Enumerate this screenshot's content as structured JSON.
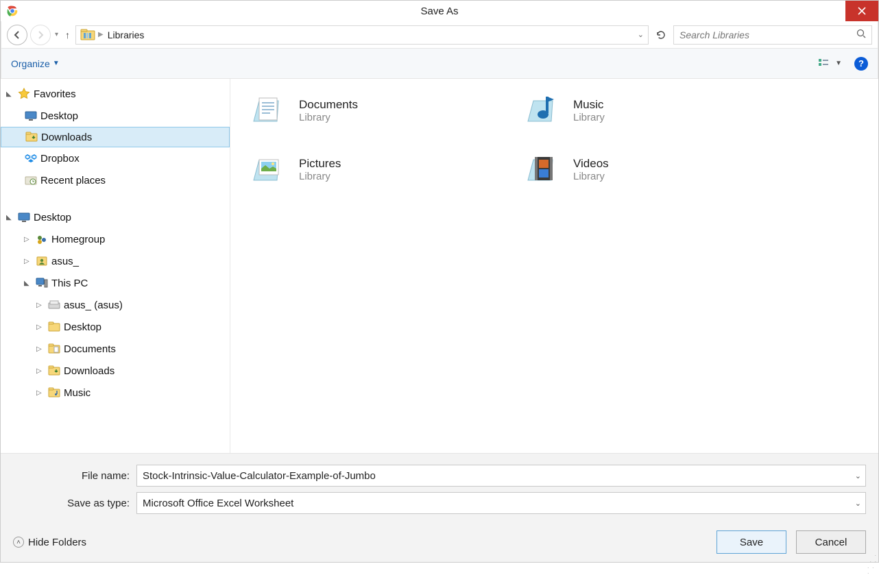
{
  "title": "Save As",
  "breadcrumb": {
    "location": "Libraries"
  },
  "search": {
    "placeholder": "Search Libraries"
  },
  "toolbar": {
    "organize": "Organize"
  },
  "tree": {
    "favorites": "Favorites",
    "fav_items": {
      "desktop": "Desktop",
      "downloads": "Downloads",
      "dropbox": "Dropbox",
      "recent": "Recent places"
    },
    "desktop": "Desktop",
    "desktop_items": {
      "homegroup": "Homegroup",
      "asus": "asus_",
      "thispc": "This PC",
      "pc_items": {
        "asus_drive": "asus_ (asus)",
        "desktop2": "Desktop",
        "documents": "Documents",
        "downloads2": "Downloads",
        "music": "Music"
      }
    }
  },
  "libs": {
    "documents": {
      "name": "Documents",
      "sub": "Library"
    },
    "music": {
      "name": "Music",
      "sub": "Library"
    },
    "pictures": {
      "name": "Pictures",
      "sub": "Library"
    },
    "videos": {
      "name": "Videos",
      "sub": "Library"
    }
  },
  "footer": {
    "filename_label": "File name:",
    "filename_value": "Stock-Intrinsic-Value-Calculator-Example-of-Jumbo",
    "savetype_label": "Save as type:",
    "savetype_value": "Microsoft Office Excel Worksheet",
    "hide_folders": "Hide Folders",
    "save": "Save",
    "cancel": "Cancel"
  }
}
